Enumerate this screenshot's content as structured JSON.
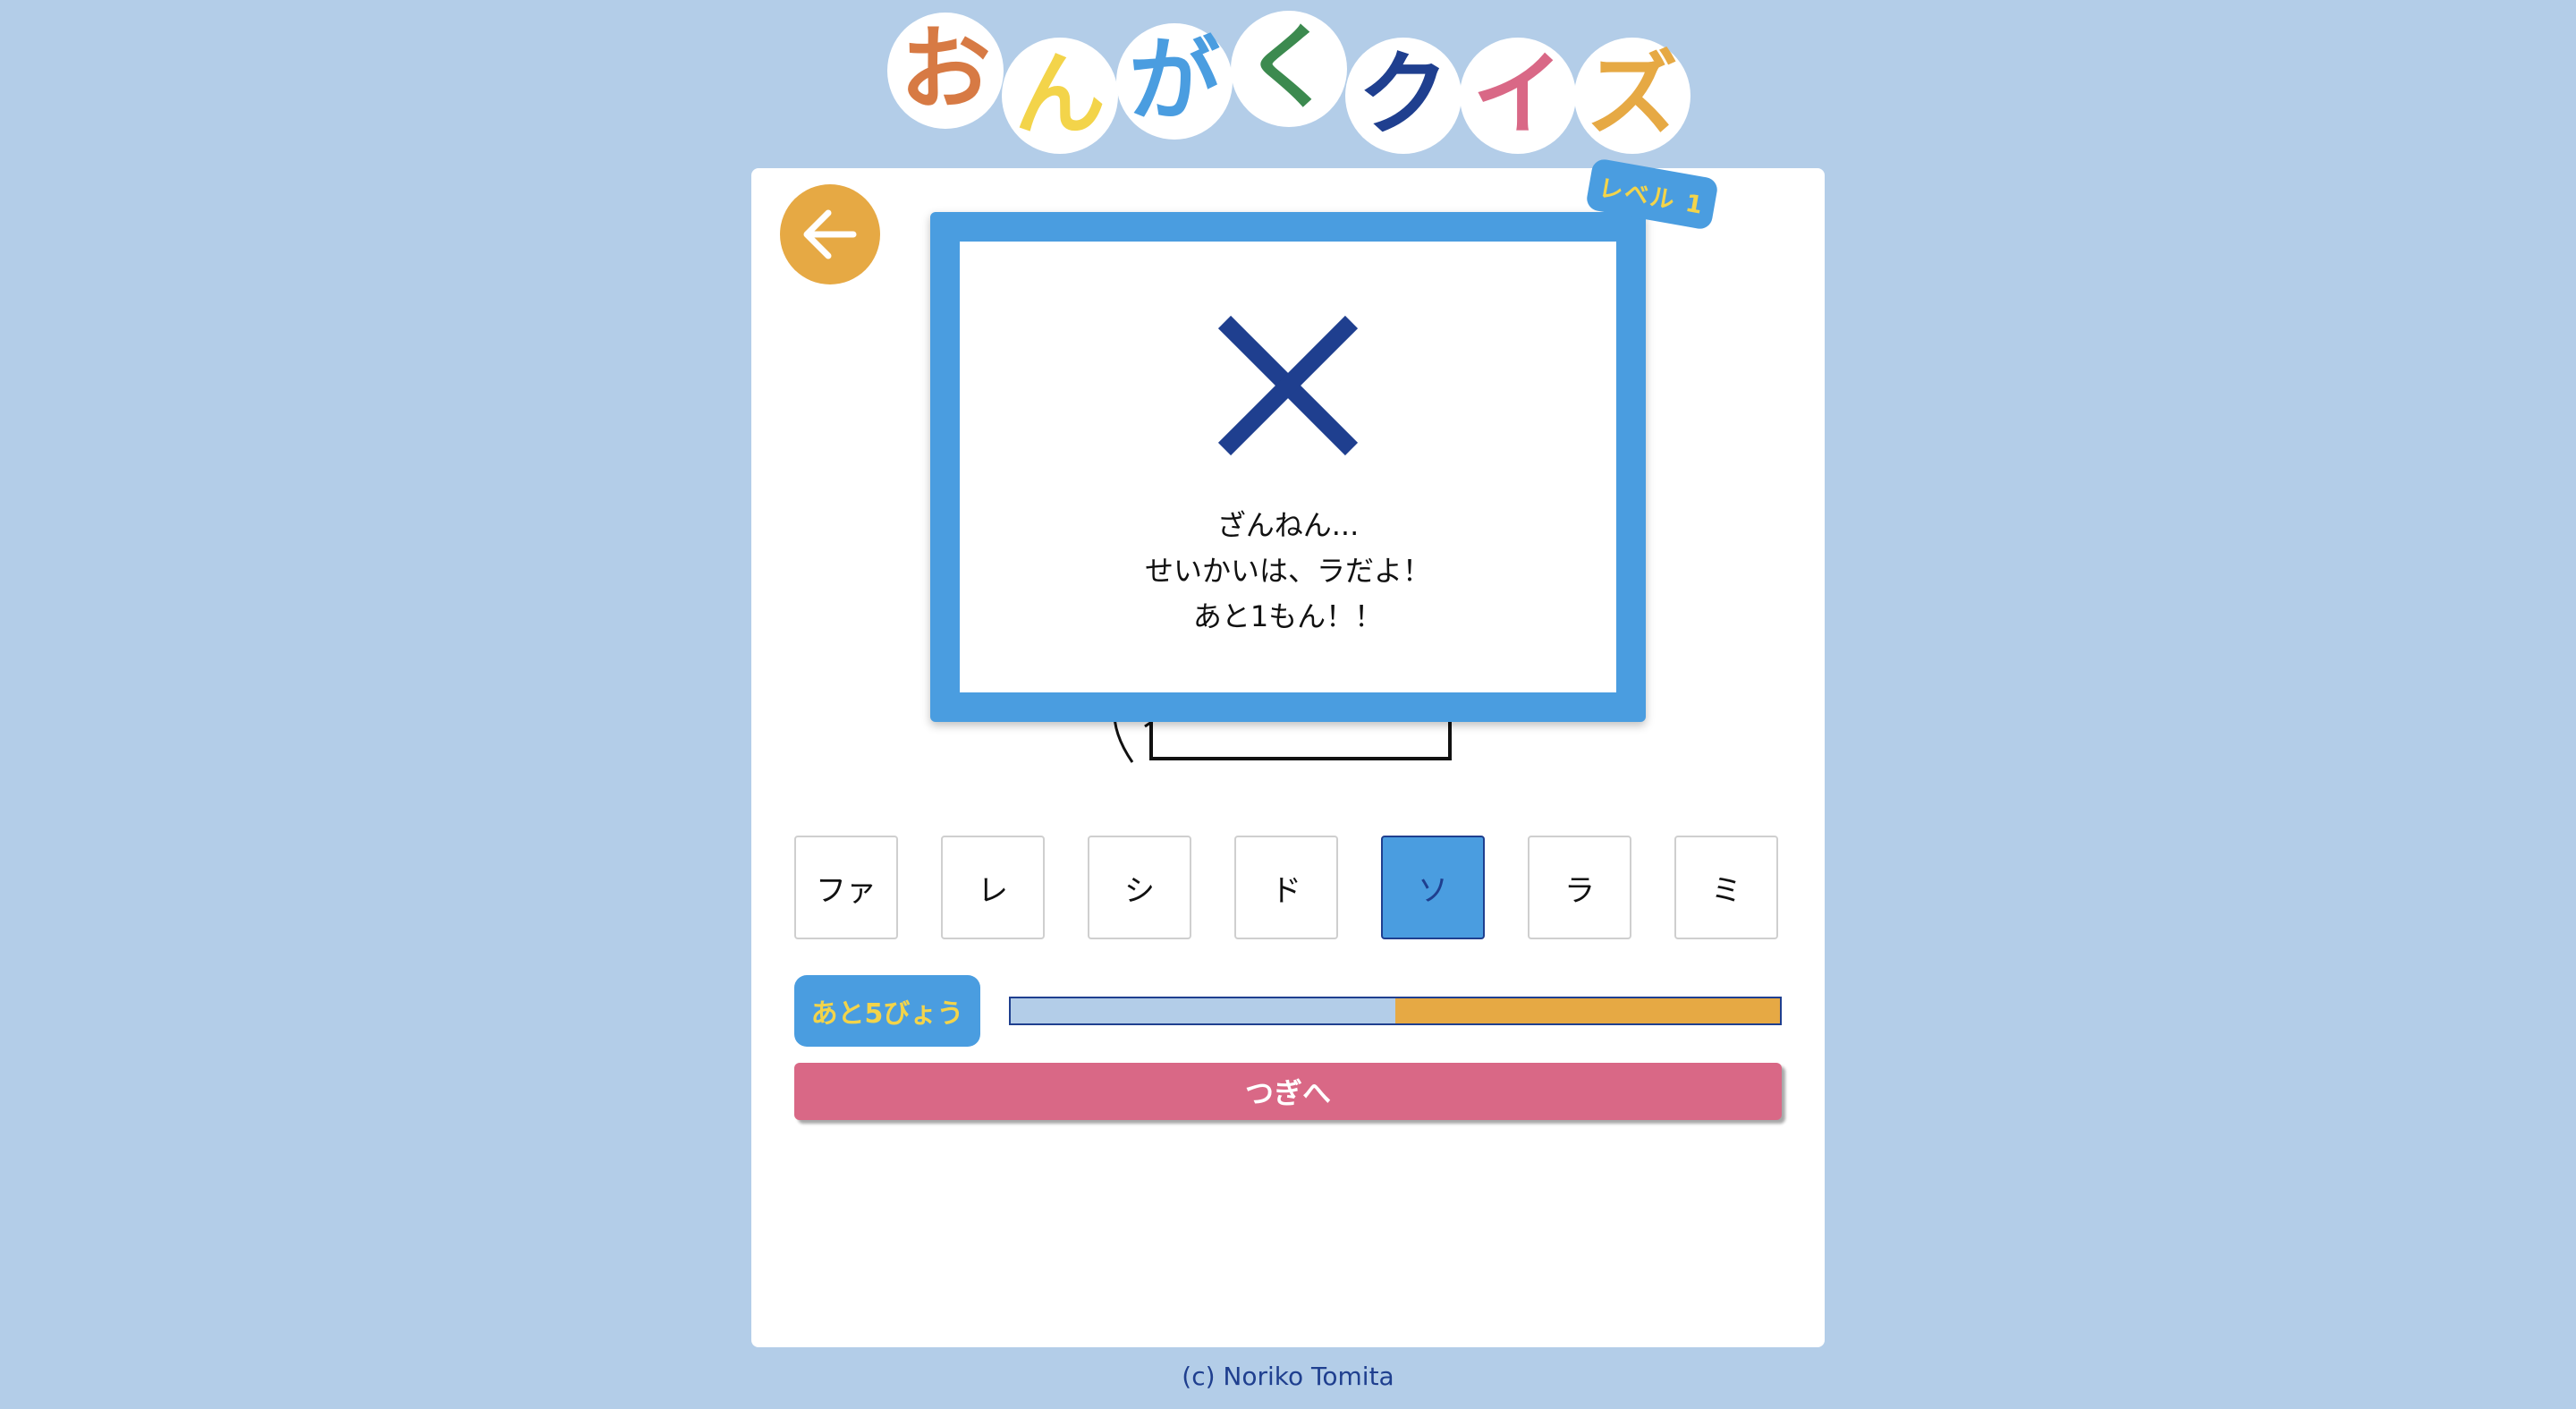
{
  "title": {
    "letters": [
      {
        "char": "お",
        "color": "#d77a44"
      },
      {
        "char": "ん",
        "color": "#f3d44a"
      },
      {
        "char": "が",
        "color": "#4a9de0"
      },
      {
        "char": "く",
        "color": "#3c8a4f"
      },
      {
        "char": "ク",
        "color": "#1f3f8f"
      },
      {
        "char": "イ",
        "color": "#d96886"
      },
      {
        "char": "ズ",
        "color": "#e6a944"
      }
    ]
  },
  "back_button": {
    "icon": "arrow-left-icon"
  },
  "level_badge": "レベル 1",
  "popup": {
    "mark": "x-mark-icon",
    "lines": [
      "ざんねん...",
      "せいかいは、ラだよ！",
      "あと1もん！！"
    ]
  },
  "notes": [
    {
      "label": "ファ",
      "selected": false
    },
    {
      "label": "レ",
      "selected": false
    },
    {
      "label": "シ",
      "selected": false
    },
    {
      "label": "ド",
      "selected": false
    },
    {
      "label": "ソ",
      "selected": true
    },
    {
      "label": "ラ",
      "selected": false
    },
    {
      "label": "ミ",
      "selected": false
    }
  ],
  "timer": {
    "label": "あと5びょう",
    "elapsed_fraction": 0.5
  },
  "next_button": "つぎへ",
  "footer": "(c) Noriko Tomita",
  "colors": {
    "background": "#b3cde8",
    "accent_blue": "#4a9de0",
    "accent_orange": "#e6a944",
    "accent_pink": "#d96886",
    "navy": "#1f3f8f",
    "yellow": "#f3d44a"
  }
}
